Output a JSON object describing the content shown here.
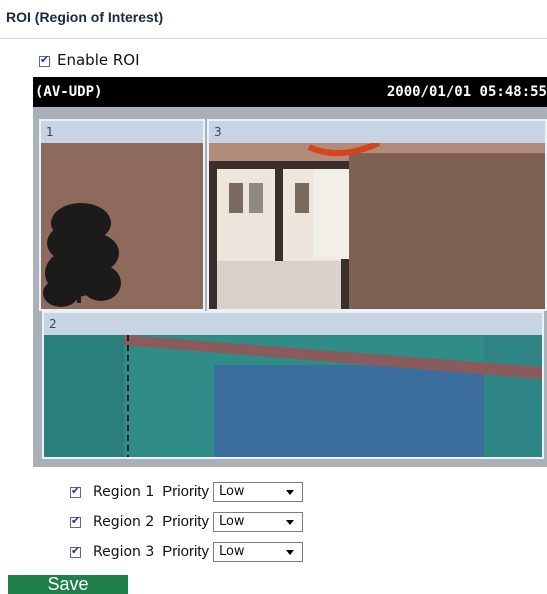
{
  "header": {
    "title": "ROI (Region of Interest)"
  },
  "enable_roi": {
    "label": "Enable ROI",
    "checked": true
  },
  "video": {
    "stream_label": "(AV-UDP)",
    "timestamp": "2000/01/01 05:48:55",
    "regions": [
      {
        "id": "1"
      },
      {
        "id": "3"
      },
      {
        "id": "2"
      }
    ]
  },
  "regions": [
    {
      "label": "Region 1",
      "priority_label": "Priority",
      "priority": "Low",
      "checked": true
    },
    {
      "label": "Region 2",
      "priority_label": "Priority",
      "priority": "Low",
      "checked": true
    },
    {
      "label": "Region 3",
      "priority_label": "Priority",
      "priority": "Low",
      "checked": true
    }
  ],
  "save_label": "Save"
}
